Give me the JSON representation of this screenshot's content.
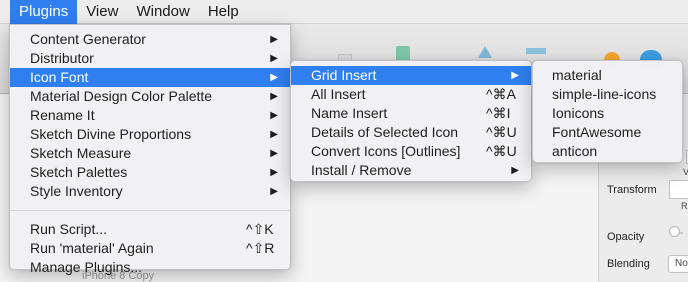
{
  "menubar": {
    "items": [
      {
        "label": "Plugins",
        "active": true
      },
      {
        "label": "View"
      },
      {
        "label": "Window"
      },
      {
        "label": "Help"
      }
    ]
  },
  "plugins_menu": {
    "items": [
      {
        "label": "Content Generator",
        "arrow": "▶"
      },
      {
        "label": "Distributor",
        "arrow": "▶"
      },
      {
        "label": "Icon Font",
        "arrow": "▶",
        "active": true
      },
      {
        "label": "Material Design Color Palette",
        "arrow": "▶"
      },
      {
        "label": "Rename It",
        "arrow": "▶"
      },
      {
        "label": "Sketch Divine Proportions",
        "arrow": "▶"
      },
      {
        "label": "Sketch Measure",
        "arrow": "▶"
      },
      {
        "label": "Sketch Palettes",
        "arrow": "▶"
      },
      {
        "label": "Style Inventory",
        "arrow": "▶"
      }
    ],
    "footer_items": [
      {
        "label": "Run Script...",
        "shortcut": "^⇧K"
      },
      {
        "label": "Run 'material' Again",
        "shortcut": "^⇧R"
      },
      {
        "label": "Manage Plugins..."
      }
    ]
  },
  "icon_font_menu": {
    "items": [
      {
        "label": "Grid Insert",
        "arrow": "▶",
        "active": true
      },
      {
        "label": "All Insert",
        "shortcut": "^⌘A"
      },
      {
        "label": "Name Insert",
        "shortcut": "^⌘I"
      },
      {
        "label": "Details of Selected Icon",
        "shortcut": "^⌘U"
      },
      {
        "label": "Convert Icons [Outlines]",
        "shortcut": "^⌘U"
      },
      {
        "label": "Install / Remove",
        "arrow": "▶"
      }
    ]
  },
  "grid_insert_menu": {
    "items": [
      {
        "label": "material"
      },
      {
        "label": "simple-line-icons"
      },
      {
        "label": "Ionicons"
      },
      {
        "label": "FontAwesome"
      },
      {
        "label": "anticon"
      }
    ]
  },
  "background": {
    "canvas_artboard_label": "iPhone 8 Copy",
    "inspector": {
      "transform_label": "Transform",
      "opacity_label": "Opacity",
      "blending_label": "Blending",
      "blending_value": "No",
      "v_label": "V",
      "r_label": "R"
    }
  },
  "colors": {
    "selection": "#2f7ff0",
    "menu_bg": "#f1f1f3"
  }
}
